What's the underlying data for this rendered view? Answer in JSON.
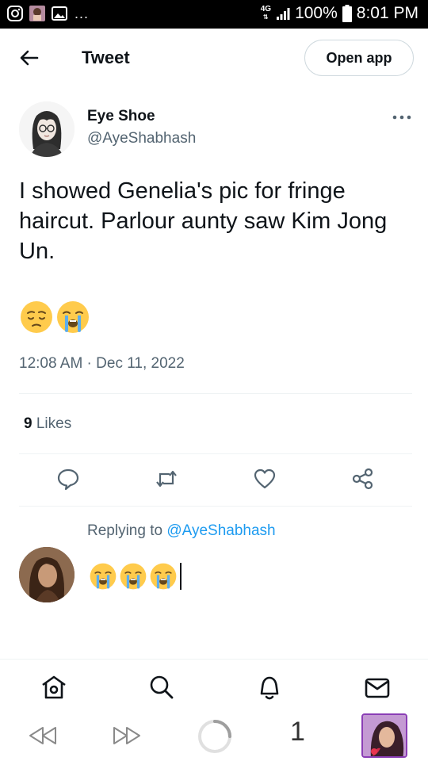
{
  "status_bar": {
    "network": "4G",
    "battery_percent": "100%",
    "time": "8:01 PM",
    "more": "..."
  },
  "header": {
    "title": "Tweet",
    "open_app_label": "Open app"
  },
  "tweet": {
    "author_name": "Eye Shoe",
    "author_handle": "@AyeShabhash",
    "text": "I showed Genelia's pic for fringe haircut. Parlour aunty saw Kim Jong Un.",
    "emojis": [
      "pensive-face",
      "loudly-crying-face"
    ],
    "timestamp": "12:08 AM · Dec 11, 2022",
    "likes_count": "9",
    "likes_label": "Likes"
  },
  "reply": {
    "replying_to_label": "Replying to",
    "replying_to_handle": "@AyeShabhash",
    "draft_emojis": [
      "loudly-crying-face",
      "loudly-crying-face",
      "loudly-crying-face"
    ]
  },
  "bottom_nav": {
    "items": [
      "home-icon",
      "search-icon",
      "notifications-icon",
      "messages-icon"
    ]
  },
  "system_bar": {
    "tab_count": "1"
  },
  "colors": {
    "accent": "#1d9bf0",
    "text_primary": "#0f1419",
    "text_secondary": "#536471",
    "divider": "#eff3f4",
    "emoji_yellow": "#ffcb4c"
  }
}
